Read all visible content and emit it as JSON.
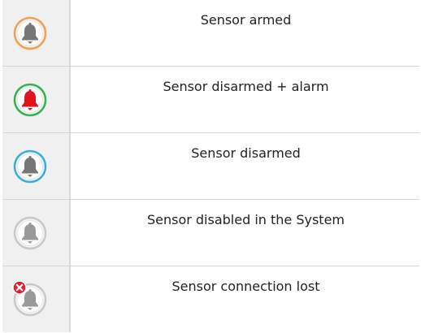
{
  "statuses": [
    {
      "label": "Sensor armed",
      "icon": "bell-armed-icon",
      "ring_color": "#f0a050",
      "bell_color": "#777777",
      "error_badge": false
    },
    {
      "label": "Sensor disarmed + alarm",
      "icon": "bell-alarm-icon",
      "ring_color": "#33b34a",
      "bell_color": "#e0141a",
      "error_badge": false
    },
    {
      "label": "Sensor disarmed",
      "icon": "bell-disarmed-icon",
      "ring_color": "#38aee0",
      "bell_color": "#777777",
      "error_badge": false
    },
    {
      "label": "Sensor disabled in the System",
      "icon": "bell-disabled-icon",
      "ring_color": "#c8c8c8",
      "bell_color": "#9a9a9a",
      "error_badge": false
    },
    {
      "label": "Sensor connection lost",
      "icon": "bell-connection-lost-icon",
      "ring_color": "#c8c8c8",
      "bell_color": "#9a9a9a",
      "error_badge": true,
      "badge_color": "#e0202a"
    }
  ]
}
